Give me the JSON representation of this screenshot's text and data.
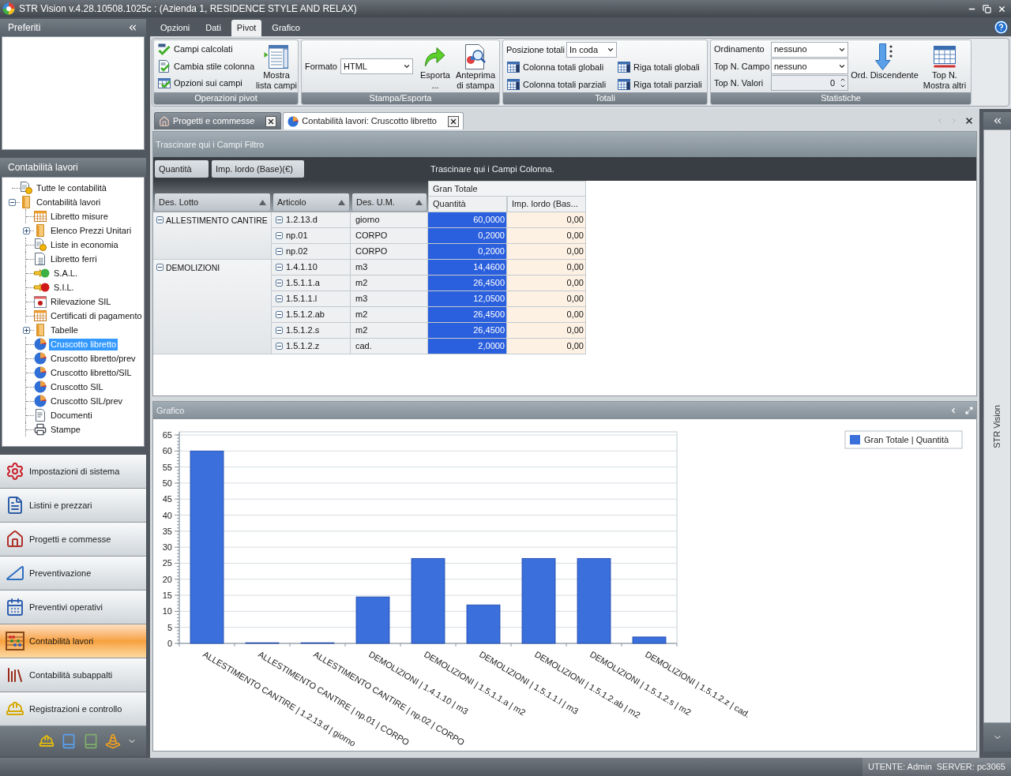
{
  "window": {
    "title": "STR Vision v.4.28.10508.1025c : (Azienda 1, RESIDENCE STYLE AND RELAX)"
  },
  "favorites_panel": {
    "title": "Preferiti"
  },
  "tree_panel": {
    "title": "Contabilità lavori",
    "items": [
      {
        "label": "Tutte le contabilità",
        "selected": false
      },
      {
        "label": "Contabilità lavori",
        "selected": false,
        "expanded": true,
        "children": [
          {
            "label": "Libretto misure",
            "selected": false
          },
          {
            "label": "Elenco Prezzi Unitari",
            "selected": false,
            "expanded": false
          },
          {
            "label": "Liste in economia",
            "selected": false
          },
          {
            "label": "Libretto ferri",
            "selected": false
          },
          {
            "label": "S.A.L.",
            "selected": false
          },
          {
            "label": "S.I.L.",
            "selected": false
          },
          {
            "label": "Rilevazione SIL",
            "selected": false
          },
          {
            "label": "Certificati di pagamento",
            "selected": false
          },
          {
            "label": "Tabelle",
            "selected": false,
            "expanded": false
          },
          {
            "label": "Cruscotto libretto",
            "selected": true
          },
          {
            "label": "Cruscotto libretto/prev",
            "selected": false
          },
          {
            "label": "Cruscotto libretto/SIL",
            "selected": false
          },
          {
            "label": "Cruscotto SIL",
            "selected": false
          },
          {
            "label": "Cruscotto SIL/prev",
            "selected": false
          },
          {
            "label": "Documenti",
            "selected": false
          },
          {
            "label": "Stampe",
            "selected": false
          }
        ]
      }
    ]
  },
  "nav_buttons": [
    {
      "label": "Impostazioni di sistema",
      "selected": false
    },
    {
      "label": "Listini e prezzari",
      "selected": false
    },
    {
      "label": "Progetti e commesse",
      "selected": false
    },
    {
      "label": "Preventivazione",
      "selected": false
    },
    {
      "label": "Preventivi operativi",
      "selected": false
    },
    {
      "label": "Contabilità lavori",
      "selected": true
    },
    {
      "label": "Contabilità subappalti",
      "selected": false
    },
    {
      "label": "Registrazioni e controllo",
      "selected": false
    }
  ],
  "ribbon": {
    "tabs": [
      {
        "label": "Opzioni",
        "selected": false
      },
      {
        "label": "Dati",
        "selected": false
      },
      {
        "label": "Pivot",
        "selected": true
      },
      {
        "label": "Grafico",
        "selected": false
      }
    ],
    "pivot_operations": {
      "title": "Operazioni pivot",
      "small_buttons": [
        "Campi calcolati",
        "Cambia stile colonna",
        "Opzioni sui campi"
      ],
      "large_button": "Mostra\nlista campi"
    },
    "print_export": {
      "title": "Stampa/Esporta",
      "format_label": "Formato",
      "format_value": "HTML",
      "buttons": [
        "Esporta\n...",
        "Anteprima\ndi stampa"
      ]
    },
    "totals": {
      "title": "Totali",
      "position_label": "Posizione totali",
      "position_value": "In coda",
      "buttons": [
        "Colonna totali globali",
        "Riga totali globali",
        "Colonna totali parziali",
        "Riga totali parziali"
      ]
    },
    "statistics": {
      "title": "Statistiche",
      "fields": [
        {
          "label": "Ordinamento",
          "value": "nessuno",
          "kind": "dropdown"
        },
        {
          "label": "Top N. Campo",
          "value": "nessuno",
          "kind": "dropdown"
        },
        {
          "label": "Top N. Valori",
          "value": "0",
          "kind": "spinner"
        }
      ],
      "buttons": [
        "Ord. Discendente",
        "Top N.\nMostra altri"
      ]
    }
  },
  "document_tabs": [
    {
      "label": "Progetti e commesse",
      "selected": false
    },
    {
      "label": "Contabilità lavori: Cruscotto libretto",
      "selected": true
    }
  ],
  "pivot": {
    "filter_area": "Trascinare qui i Campi Filtro",
    "data_fields": [
      "Quantità",
      "Imp. lordo (Base)(€)"
    ],
    "column_area": "Trascinare qui i Campi Colonna.",
    "row_fields": [
      "Des. Lotto",
      "Articolo",
      "Des. U.M."
    ],
    "column_total": "Gran Totale",
    "value_columns": [
      "Quantità",
      "Imp. lordo (Bas..."
    ],
    "groups": [
      {
        "label": "ALLESTIMENTO CANTIRE",
        "expanded": true,
        "rows": [
          {
            "article": "1.2.13.d",
            "expanded": true,
            "unit": "giorno",
            "quantity": "60,0000",
            "amount": "0,00",
            "selected": true
          },
          {
            "article": "np.01",
            "expanded": true,
            "unit": "CORPO",
            "quantity": "0,2000",
            "amount": "0,00",
            "selected": true
          },
          {
            "article": "np.02",
            "expanded": true,
            "unit": "CORPO",
            "quantity": "0,2000",
            "amount": "0,00",
            "selected": true
          }
        ]
      },
      {
        "label": "DEMOLIZIONI",
        "expanded": true,
        "rows": [
          {
            "article": "1.4.1.10",
            "expanded": true,
            "unit": "m3",
            "quantity": "14,4600",
            "amount": "0,00",
            "selected": true
          },
          {
            "article": "1.5.1.1.a",
            "expanded": true,
            "unit": "m2",
            "quantity": "26,4500",
            "amount": "0,00",
            "selected": true
          },
          {
            "article": "1.5.1.1.l",
            "expanded": true,
            "unit": "m3",
            "quantity": "12,0500",
            "amount": "0,00",
            "selected": true
          },
          {
            "article": "1.5.1.2.ab",
            "expanded": true,
            "unit": "m2",
            "quantity": "26,4500",
            "amount": "0,00",
            "selected": true
          },
          {
            "article": "1.5.1.2.s",
            "expanded": true,
            "unit": "m2",
            "quantity": "26,4500",
            "amount": "0,00",
            "selected": true
          },
          {
            "article": "1.5.1.2.z",
            "expanded": true,
            "unit": "cad.",
            "quantity": "2,0000",
            "amount": "0,00",
            "selected": true
          }
        ]
      }
    ]
  },
  "chart_panel": {
    "title": "Grafico",
    "chart_data": {
      "type": "bar",
      "grid": true,
      "categories": [
        "ALLESTIMENTO CANTIRE | 1.2.13.d | giorno",
        "ALLESTIMENTO CANTIRE | np.01 | CORPO",
        "ALLESTIMENTO CANTIRE | np.02 | CORPO",
        "DEMOLIZIONI | 1.4.1.10 | m3",
        "DEMOLIZIONI | 1.5.1.1.a | m2",
        "DEMOLIZIONI | 1.5.1.1.l | m3",
        "DEMOLIZIONI | 1.5.1.2.ab | m2",
        "DEMOLIZIONI | 1.5.1.2.s | m2",
        "DEMOLIZIONI | 1.5.1.2.z | cad."
      ],
      "series": [
        {
          "name": "Gran Totale | Quantità",
          "color": "#3a6fdc",
          "values": [
            60,
            0.2,
            0.2,
            14.5,
            26.5,
            12,
            26.5,
            26.5,
            2
          ]
        }
      ],
      "ylim": [
        0,
        65
      ],
      "yticks": [
        0,
        5,
        10,
        15,
        20,
        25,
        30,
        35,
        40,
        45,
        50,
        55,
        60,
        65
      ]
    }
  },
  "side_panel": {
    "title": "STR Vision"
  },
  "status_bar": {
    "user": "UTENTE: Admin",
    "server": "SERVER: pc3065"
  }
}
